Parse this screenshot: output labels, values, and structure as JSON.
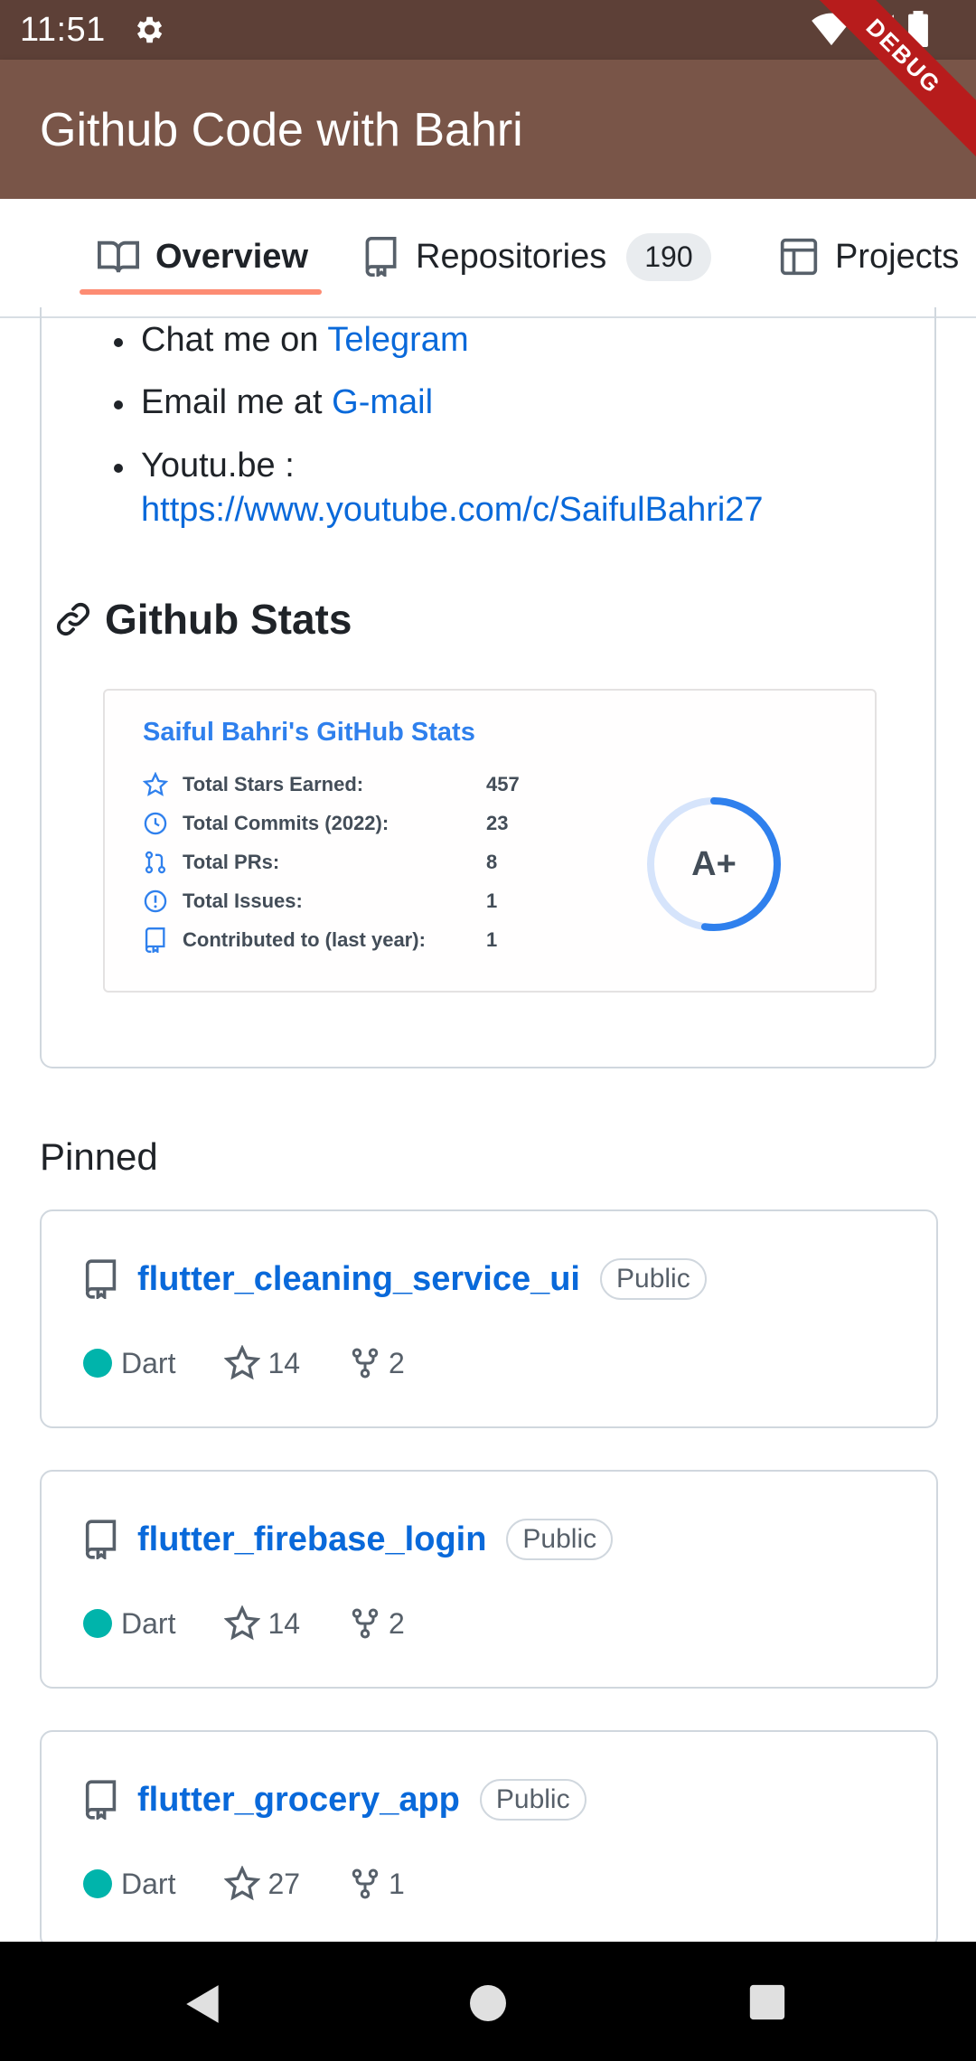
{
  "status_bar": {
    "time": "11:51"
  },
  "app_bar": {
    "title": "Github Code with Bahri",
    "debug_label": "DEBUG"
  },
  "tabs": [
    {
      "label": "Overview",
      "icon": "book-icon",
      "active": true
    },
    {
      "label": "Repositories",
      "icon": "repo-icon",
      "count": "190"
    },
    {
      "label": "Projects",
      "icon": "table-icon"
    }
  ],
  "readme": {
    "contacts": [
      {
        "prefix": "Chat me on ",
        "link": "Telegram"
      },
      {
        "prefix": "Email me at ",
        "link": "G-mail"
      },
      {
        "prefix": "Youtu.be :",
        "link": "https://www.youtube.com/c/SaifulBahri27"
      }
    ],
    "stats_heading": "Github Stats",
    "stats_card": {
      "title": "Saiful Bahri's GitHub Stats",
      "rows": [
        {
          "label": "Total Stars Earned:",
          "value": "457",
          "icon": "star-icon"
        },
        {
          "label": "Total Commits (2022):",
          "value": "23",
          "icon": "history-icon"
        },
        {
          "label": "Total PRs:",
          "value": "8",
          "icon": "pull-request-icon"
        },
        {
          "label": "Total Issues:",
          "value": "1",
          "icon": "issue-icon"
        },
        {
          "label": "Contributed to (last year):",
          "value": "1",
          "icon": "repo-icon"
        }
      ],
      "grade": "A+",
      "accent_color": "#2f80ed"
    }
  },
  "pinned": {
    "label": "Pinned",
    "repos": [
      {
        "name": "flutter_cleaning_service_ui",
        "visibility": "Public",
        "language": "Dart",
        "stars": "14",
        "forks": "2"
      },
      {
        "name": "flutter_firebase_login",
        "visibility": "Public",
        "language": "Dart",
        "stars": "14",
        "forks": "2"
      },
      {
        "name": "flutter_grocery_app",
        "visibility": "Public",
        "language": "Dart",
        "stars": "27",
        "forks": "1"
      }
    ]
  },
  "colors": {
    "status_bar": "#5d4037",
    "app_bar": "#795548",
    "link": "#0969da",
    "dart": "#00b4ab",
    "tab_underline": "#fd8c73"
  }
}
